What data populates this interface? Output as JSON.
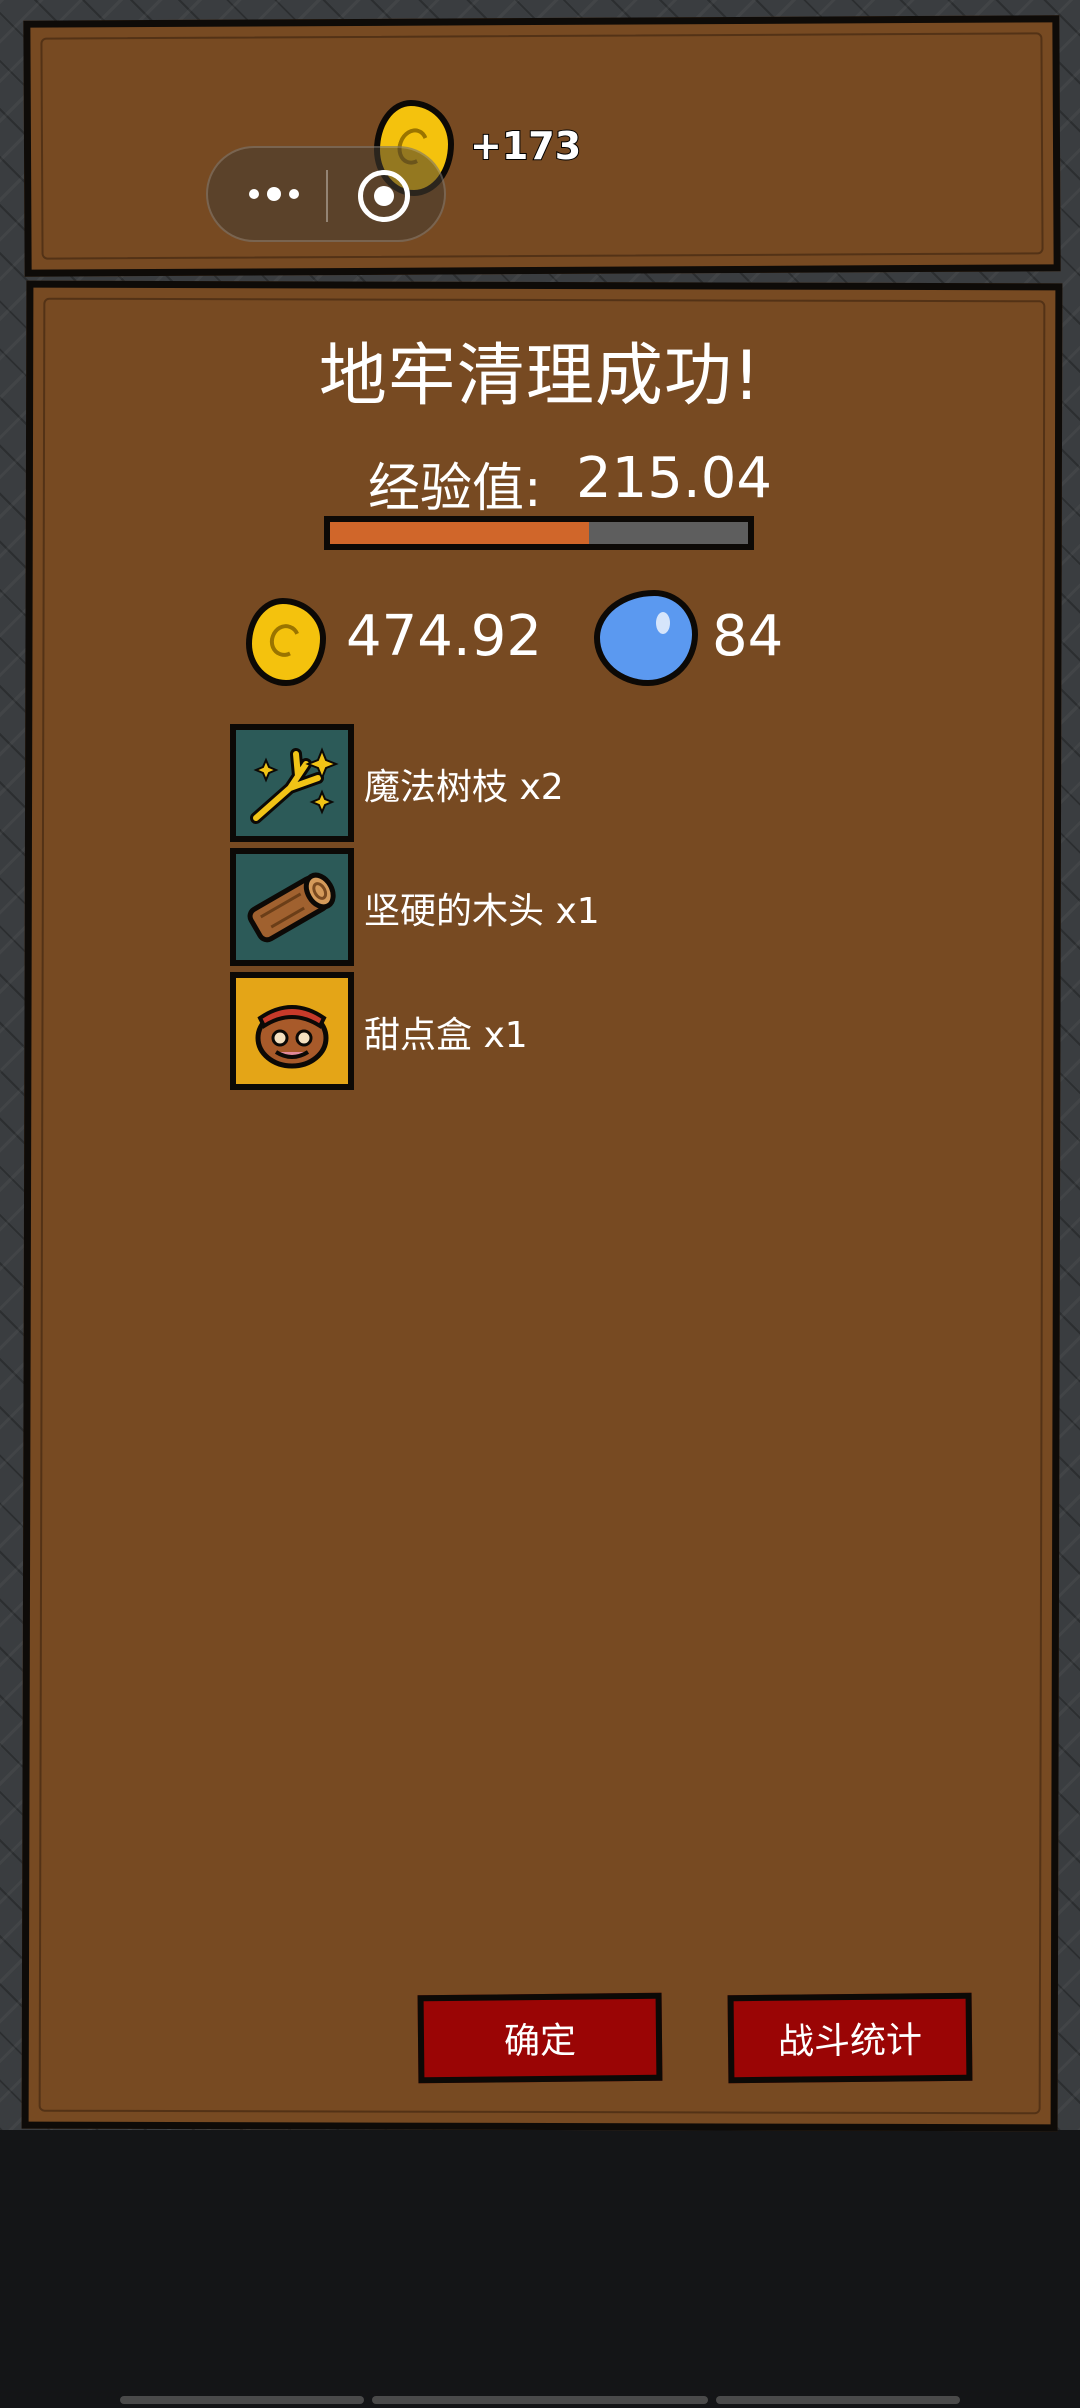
{
  "header": {
    "gold_gain": "+173"
  },
  "result": {
    "title": "地牢清理成功!",
    "exp_label": "经验值:",
    "exp_value": "215.04",
    "exp_progress_fraction": 0.62,
    "gold_amount": "474.92",
    "gem_amount": "84"
  },
  "items": [
    {
      "label": "魔法树枝 x2",
      "icon": "magic-branch-icon"
    },
    {
      "label": "坚硬的木头 x1",
      "icon": "hard-wood-icon"
    },
    {
      "label": "甜点盒 x1",
      "icon": "dessert-box-icon"
    }
  ],
  "buttons": {
    "confirm": "确定",
    "battle_stats": "战斗统计"
  },
  "colors": {
    "board_brown": "#774a22",
    "outline": "#0c0906",
    "coin_gold": "#f4c20d",
    "gem_blue": "#5b99f0",
    "button_red": "#9a0505",
    "exp_fill": "#d0662a",
    "slot_teal": "#2c5a58",
    "slot_yellow": "#e4a517"
  }
}
